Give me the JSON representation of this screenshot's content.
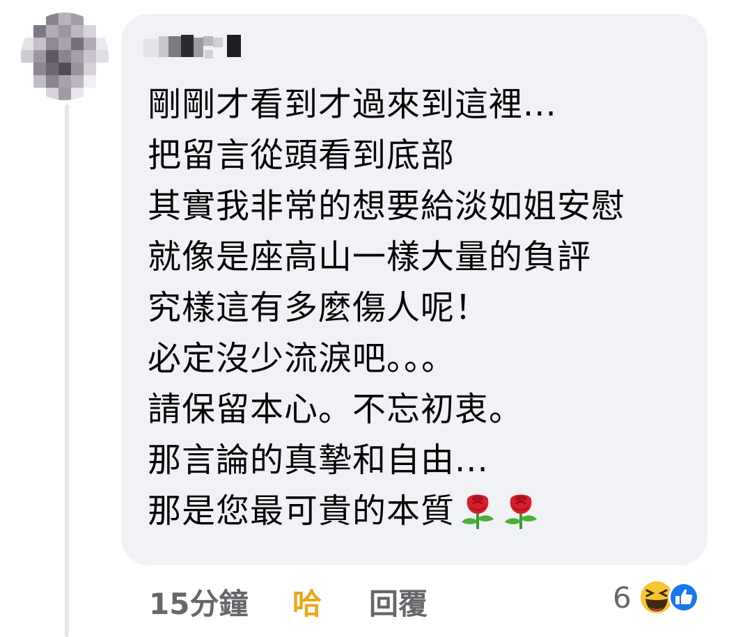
{
  "comment": {
    "author_name_hidden": true,
    "lines": [
      "剛剛才看到才過來到這裡...",
      "把留言從頭看到底部",
      "其實我非常的想要給淡如姐安慰",
      "就像是座高山一樣大量的負評",
      "究樣這有多麼傷人呢！",
      "必定沒少流淚吧。。。",
      "請保留本心。不忘初衷。",
      "那言論的真摯和自由...",
      "那是您最可貴的本質"
    ],
    "emoji": [
      "rose-icon",
      "rose-icon"
    ]
  },
  "actions": {
    "time": "15分鐘",
    "react_label": "哈",
    "reply_label": "回覆"
  },
  "reactions": {
    "count": "6",
    "icons": [
      "haha-icon",
      "like-icon"
    ]
  },
  "colors": {
    "bubble": "#f0f2f5",
    "text": "#050505",
    "secondary": "#65676b",
    "haha_active": "#e8a81b",
    "like_blue": "#1877f2"
  }
}
